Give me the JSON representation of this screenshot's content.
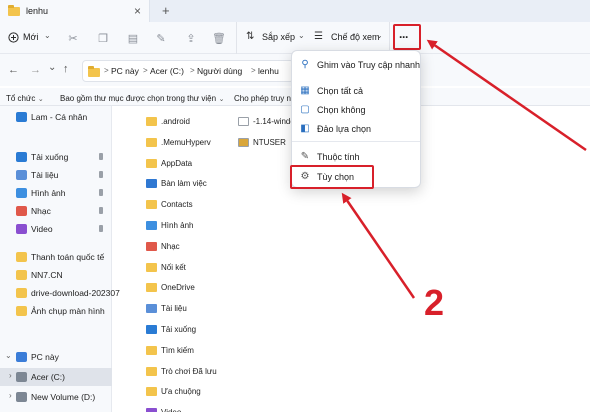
{
  "window": {
    "tab_title": "lenhu",
    "close_glyph": "×",
    "new_tab_glyph": "+"
  },
  "command_bar": {
    "new_label": "Mới",
    "sort_label": "Sắp xếp",
    "view_label": "Chế độ xem",
    "more_glyph": "···"
  },
  "address": {
    "breadcrumb": [
      "PC này",
      "Acer (C:)",
      "Người dùng",
      "lenhu"
    ],
    "separator": ">"
  },
  "options_row": {
    "organize": "Tổ chức",
    "include_library": "Bao gồm thư mục được chọn trong thư viện",
    "allow_access": "Cho phép truy nhậ"
  },
  "nav_pane": {
    "items": [
      {
        "label": "Lam - Cá nhân",
        "icon": "cloud-icon"
      },
      {
        "label": "Tải xuống",
        "icon": "download-icon",
        "pinned": true
      },
      {
        "label": "Tài liệu",
        "icon": "document-icon",
        "pinned": true
      },
      {
        "label": "Hình ảnh",
        "icon": "pictures-icon",
        "pinned": true
      },
      {
        "label": "Nhạc",
        "icon": "music-icon",
        "pinned": true
      },
      {
        "label": "Video",
        "icon": "video-icon",
        "pinned": true
      },
      {
        "label": "Thanh toán quốc tế",
        "icon": "folder-icon"
      },
      {
        "label": "NN7.CN",
        "icon": "folder-icon"
      },
      {
        "label": "drive-download-202307",
        "icon": "folder-icon"
      },
      {
        "label": "Ảnh chụp màn hình",
        "icon": "folder-icon"
      },
      {
        "label": "PC này",
        "icon": "pc-icon"
      },
      {
        "label": "Acer (C:)",
        "icon": "drive-icon",
        "selected": true
      },
      {
        "label": "New Volume (D:)",
        "icon": "drive-icon"
      }
    ]
  },
  "content": {
    "col1": [
      ".android",
      ".MemuHyperv",
      "AppData",
      "Bàn làm việc",
      "Contacts",
      "Hình ảnh",
      "Nhạc",
      "Nối kết",
      "OneDrive",
      "Tài liệu",
      "Tải xuống",
      "Tìm kiếm",
      "Trò chơi Đã lưu",
      "Ưa chuộng",
      "Video"
    ],
    "col2": [
      "-1.14-window",
      "NTUSER"
    ]
  },
  "more_menu": {
    "items": [
      {
        "label": "Ghim vào Truy cập nhanh",
        "icon": "pin-icon"
      },
      {
        "label": "Chọn tất cả",
        "icon": "select-all-icon"
      },
      {
        "label": "Chọn không",
        "icon": "select-none-icon"
      },
      {
        "label": "Đảo lựa chọn",
        "icon": "invert-selection-icon"
      },
      {
        "label": "Thuộc tính",
        "icon": "properties-icon"
      },
      {
        "label": "Tùy chọn",
        "icon": "options-icon"
      }
    ]
  },
  "annotations": {
    "step_number": "2",
    "accent_color": "#d8202a"
  }
}
